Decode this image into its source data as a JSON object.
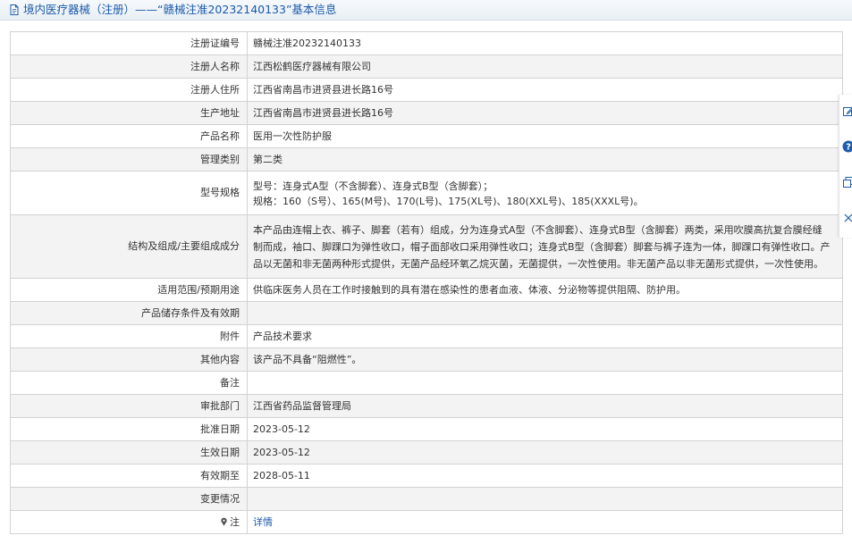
{
  "header": {
    "title": "境内医疗器械（注册）——“赣械注准20232140133”基本信息"
  },
  "rows": [
    {
      "label": "注册证编号",
      "value": "赣械注准20232140133"
    },
    {
      "label": "注册人名称",
      "value": "江西松鹤医疗器械有限公司"
    },
    {
      "label": "注册人住所",
      "value": "江西省南昌市进贤县进长路16号"
    },
    {
      "label": "生产地址",
      "value": "江西省南昌市进贤县进长路16号"
    },
    {
      "label": "产品名称",
      "value": "医用一次性防护服"
    },
    {
      "label": "管理类别",
      "value": "第二类"
    },
    {
      "label": "型号规格",
      "lines": [
        "型号：连身式A型（不含脚套）、连身式B型（含脚套）；",
        "规格：160（S号）、165(M号)、170(L号)、175(XL号)、180(XXL号)、185(XXXL号)。"
      ]
    },
    {
      "label": "结构及组成/主要组成成分",
      "lines": [
        "本产品由连帽上衣、裤子、脚套（若有）组成，分为连身式A型（不含脚套）、连身式B型（含脚套）两类，采用吹膜高抗复合膜经缝",
        "制而成，袖口、脚踝口为弹性收口，帽子面部收口采用弹性收口；连身式B型（含脚套）脚套与裤子连为一体，脚踝口有弹性收口。产",
        "品以无菌和非无菌两种形式提供，无菌产品经环氧乙烷灭菌，无菌提供，一次性使用。非无菌产品以非无菌形式提供，一次性使用。"
      ]
    },
    {
      "label": "适用范围/预期用途",
      "value": "供临床医务人员在工作时接触到的具有潜在感染性的患者血液、体液、分泌物等提供阻隔、防护用。"
    },
    {
      "label": "产品储存条件及有效期",
      "value": ""
    },
    {
      "label": "附件",
      "value": "产品技术要求"
    },
    {
      "label": "其他内容",
      "value": "该产品不具备“阻燃性”。"
    },
    {
      "label": "备注",
      "value": ""
    },
    {
      "label": "审批部门",
      "value": "江西省药品监督管理局"
    },
    {
      "label": "批准日期",
      "value": "2023-05-12"
    },
    {
      "label": "生效日期",
      "value": "2023-05-12"
    },
    {
      "label": "有效期至",
      "value": "2028-05-11"
    },
    {
      "label": "变更情况",
      "value": ""
    },
    {
      "label": "注",
      "value": "详情"
    }
  ],
  "icons": {
    "header_icon": "document-icon",
    "note_icon": "location-pin-icon",
    "tools": [
      "edit-icon",
      "help-icon",
      "copy-icon",
      "close-icon"
    ]
  },
  "colors": {
    "link": "#1b5aa8",
    "help": "#1b5aa8"
  }
}
